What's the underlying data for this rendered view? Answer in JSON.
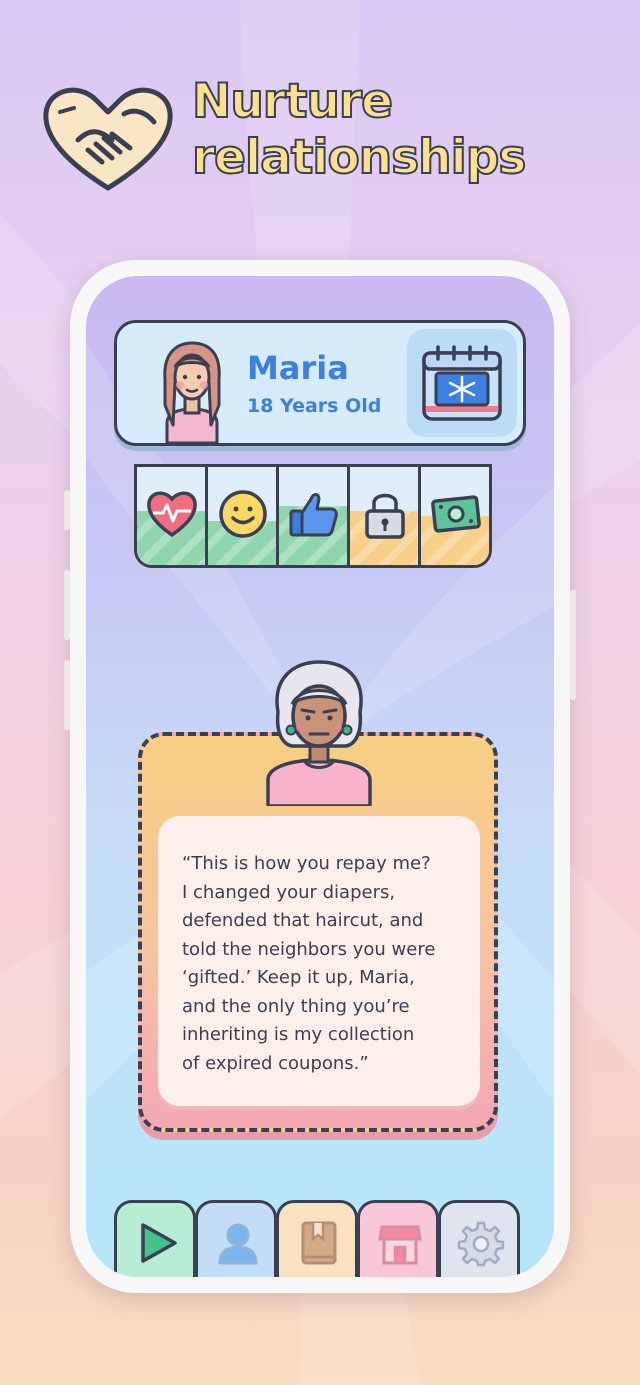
{
  "header": {
    "title_line1": "Nurture",
    "title_line2": "relationships",
    "logo_icon": "handshake-heart-icon"
  },
  "profile": {
    "name": "Maria",
    "age": "18 Years Old",
    "calendar_icon": "winter-calendar-icon"
  },
  "stats": [
    {
      "icon": "heart-health-icon",
      "level": 0.55,
      "color": "#8fd6ae"
    },
    {
      "icon": "smiley-happiness-icon",
      "level": 0.45,
      "color": "#8fd6ae"
    },
    {
      "icon": "thumbs-up-icon",
      "level": 0.6,
      "color": "#8fd6ae"
    },
    {
      "icon": "padlock-icon",
      "level": 0.55,
      "color": "#f8cf88"
    },
    {
      "icon": "money-icon",
      "level": 0.5,
      "color": "#f8cf88"
    }
  ],
  "dialog": {
    "lines": [
      "“This is how you repay me?",
      "I changed your diapers,",
      "defended that haircut, and",
      "told the neighbors you were",
      "‘gifted.’ Keep it up, Maria,",
      "and the only thing you’re",
      "inheriting is my collection",
      "of expired coupons.”"
    ]
  },
  "nav": [
    {
      "icon": "play-icon",
      "color": "#b8ecd4"
    },
    {
      "icon": "person-icon",
      "color": "#c4ddf7"
    },
    {
      "icon": "book-icon",
      "color": "#f8e2c2"
    },
    {
      "icon": "shop-icon",
      "color": "#f8c6d8"
    },
    {
      "icon": "gear-icon",
      "color": "#dfe4ef"
    }
  ]
}
